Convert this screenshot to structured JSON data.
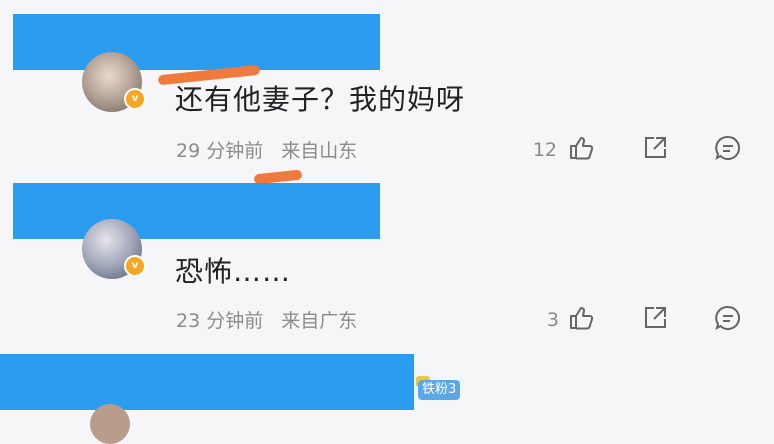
{
  "colors": {
    "redaction": "#2b9cf0",
    "scribble": "#f07a3c",
    "verified": "#f5a623",
    "meta_text": "#8c8c8c"
  },
  "comments": [
    {
      "text": "还有他妻子？我的妈呀",
      "time": "29 分钟前",
      "location": "来自山东",
      "likes": "12",
      "icons": [
        "thumbs-up-icon",
        "share-icon",
        "reply-icon"
      ]
    },
    {
      "text": "恐怖……",
      "time": "23 分钟前",
      "location": "来自广东",
      "likes": "3",
      "icons": [
        "thumbs-up-icon",
        "share-icon",
        "reply-icon"
      ]
    }
  ],
  "partial_badge": {
    "text": "铁粉3"
  },
  "verify_mark": "v"
}
